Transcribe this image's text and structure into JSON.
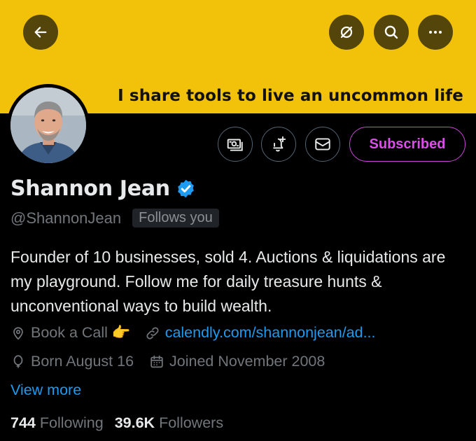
{
  "banner": {
    "text": "I share tools to live an uncommon life",
    "color": "#f2c10a"
  },
  "topbar": {
    "back_icon": "arrow-left-icon",
    "grok_icon": "slashed-circle-icon",
    "search_icon": "search-icon",
    "more_icon": "more-horizontal-icon"
  },
  "actions": {
    "tip_icon": "money-icon",
    "notify_icon": "bell-plus-icon",
    "message_icon": "envelope-icon",
    "subscribed_label": "Subscribed",
    "subscribed_color": "#d94fe8"
  },
  "profile": {
    "name": "Shannon Jean",
    "handle": "@ShannonJean",
    "follows_you": "Follows you",
    "bio": "Founder of 10 businesses, sold 4. Auctions & liquidations are my playground. Follow me for daily treasure hunts & unconventional ways to build wealth.",
    "verified_color": "#1d9bf0"
  },
  "meta": {
    "profession": "Book a Call 👉",
    "website": "calendly.com/shannonjean/ad...",
    "birthday": "Born August 16",
    "joined": "Joined November 2008"
  },
  "view_more": "View more",
  "stats": {
    "following_count": "744",
    "following_label": "Following",
    "followers_count": "39.6K",
    "followers_label": "Followers"
  }
}
